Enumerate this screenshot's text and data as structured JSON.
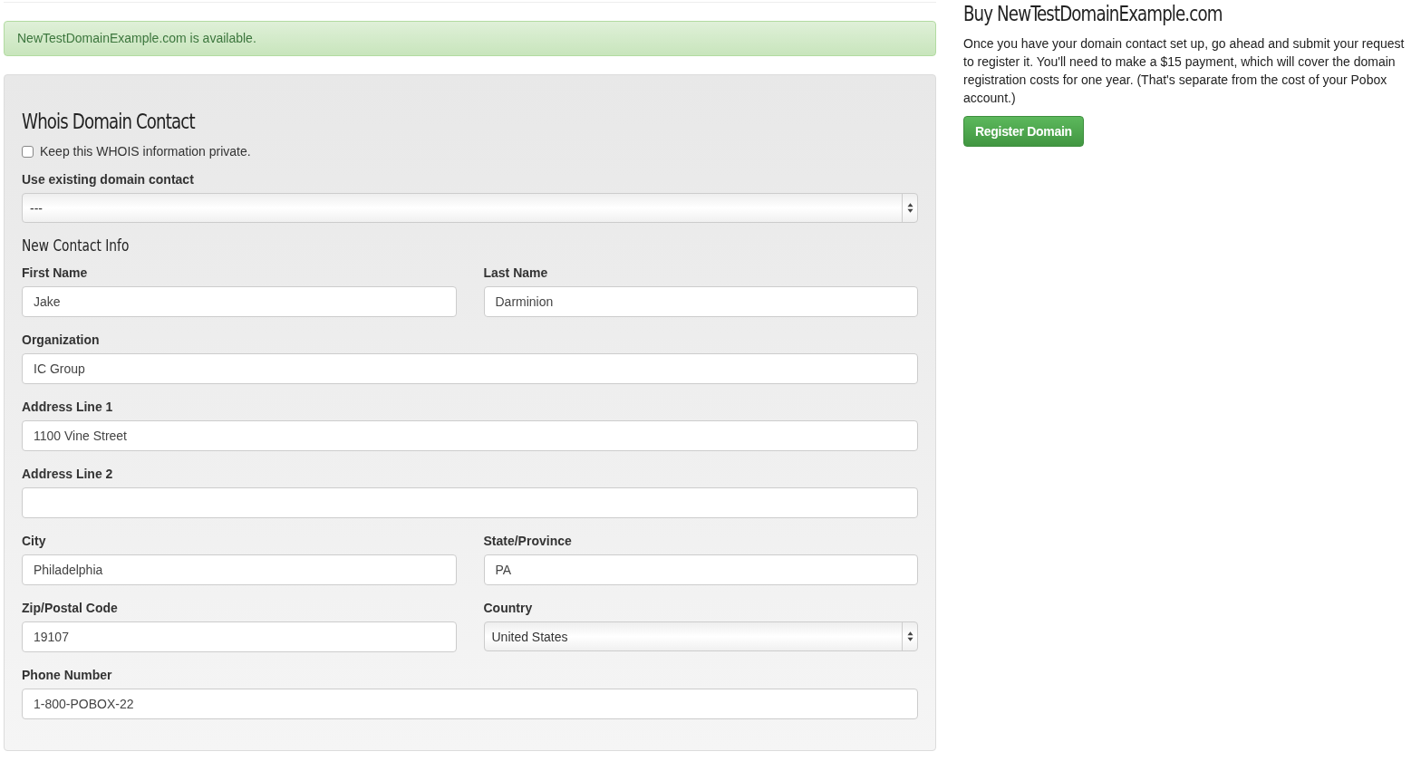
{
  "alert": {
    "text": "NewTestDomainExample.com is available."
  },
  "contact": {
    "title": "Whois Domain Contact",
    "private": {
      "label": "Keep this WHOIS information private.",
      "checked": false
    },
    "existing": {
      "label": "Use existing domain contact",
      "value": "---"
    },
    "subtitle": "New Contact Info",
    "rows": [
      [
        {
          "label": "First Name",
          "value": "Jake",
          "kind": "text"
        },
        {
          "label": "Last Name",
          "value": "Darminion",
          "kind": "text"
        }
      ],
      [
        {
          "label": "Organization",
          "value": "IC Group",
          "kind": "text"
        }
      ],
      [
        {
          "label": "Address Line 1",
          "value": "1100 Vine Street",
          "kind": "text"
        }
      ],
      [
        {
          "label": "Address Line 2",
          "kind": "text"
        }
      ],
      [
        {
          "label": "City",
          "value": "Philadelphia",
          "kind": "text"
        },
        {
          "label": "State/Province",
          "value": "PA",
          "kind": "text"
        }
      ],
      [
        {
          "label": "Zip/Postal Code",
          "value": "19107",
          "kind": "text"
        },
        {
          "label": "Country",
          "value": "United States",
          "kind": "select"
        }
      ],
      [
        {
          "label": "Phone Number",
          "value": "1-800-POBOX-22",
          "kind": "text"
        }
      ]
    ]
  },
  "buy": {
    "title": "Buy NewTestDomainExample.com",
    "text": "Once you have your domain contact set up, go ahead and submit your request to register it. You'll need to make a $15 payment, which will cover the domain registration costs for one year. (That's separate from the cost of your Pobox account.)",
    "button": "Register Domain"
  }
}
